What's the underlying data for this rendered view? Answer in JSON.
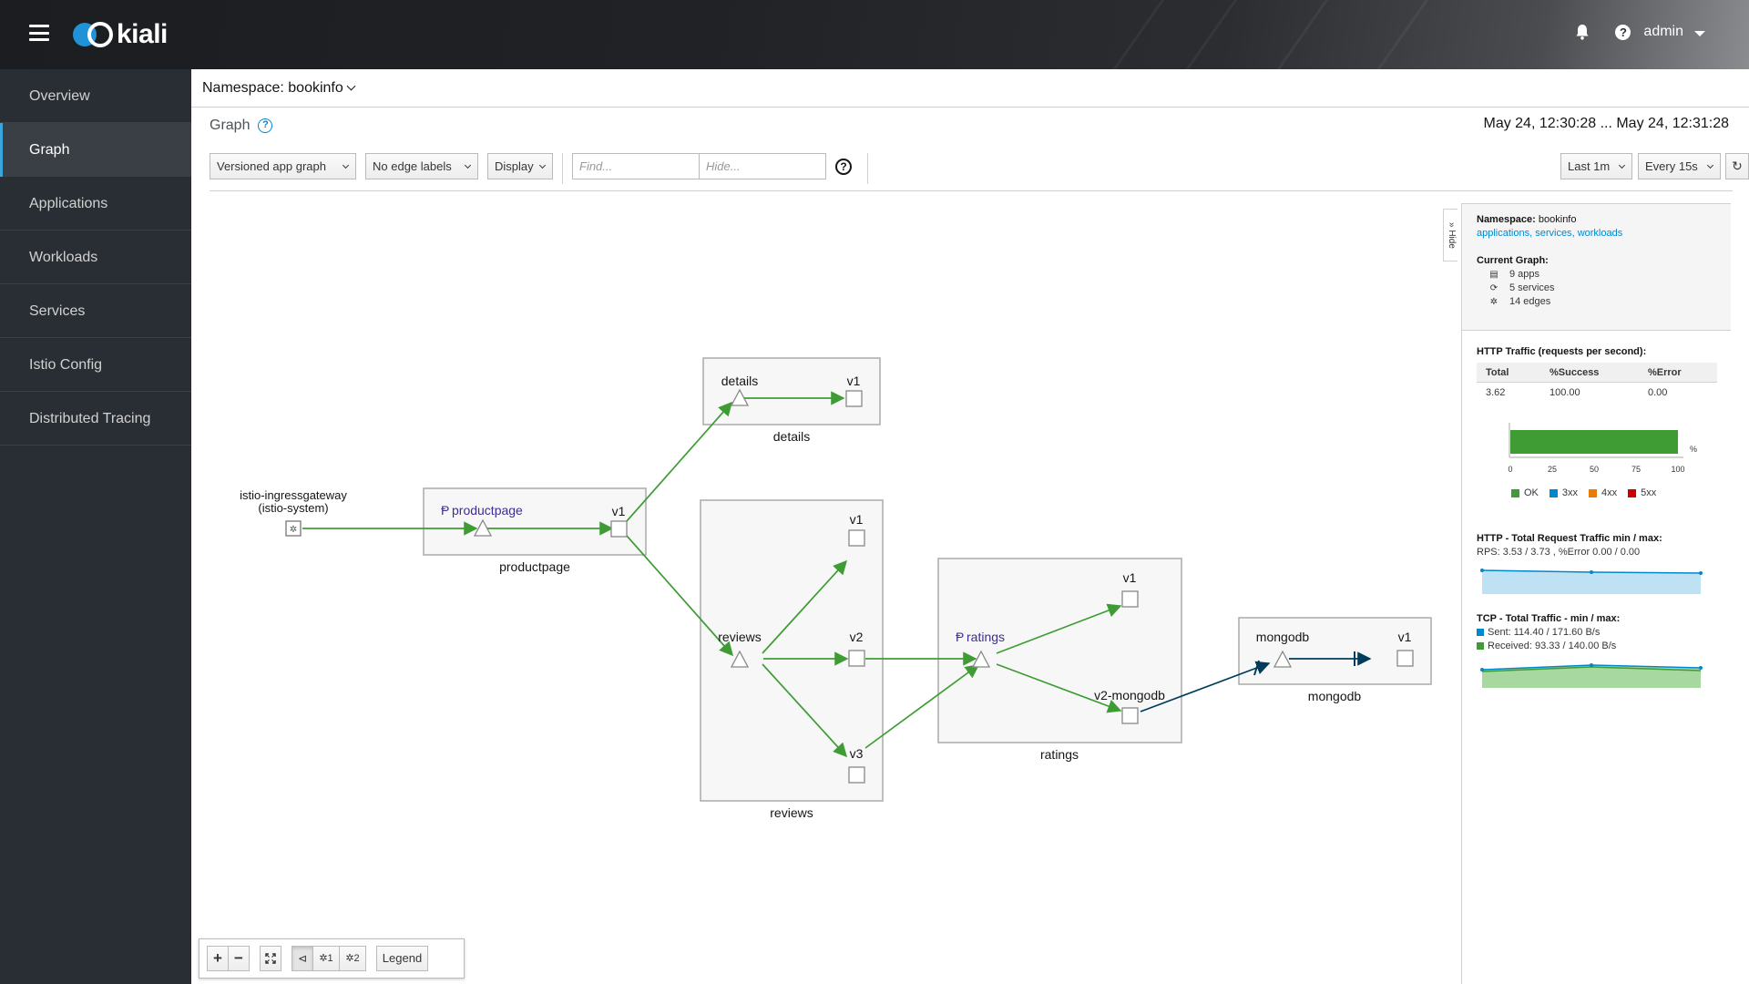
{
  "masthead": {
    "logo_text": "kiali",
    "help_label": "?",
    "user": "admin"
  },
  "sidebar": {
    "items": [
      {
        "label": "Overview"
      },
      {
        "label": "Graph"
      },
      {
        "label": "Applications"
      },
      {
        "label": "Workloads"
      },
      {
        "label": "Services"
      },
      {
        "label": "Istio Config"
      },
      {
        "label": "Distributed Tracing"
      }
    ],
    "active": "Graph"
  },
  "namespace_bar": {
    "label": "Namespace: bookinfo"
  },
  "page": {
    "title": "Graph",
    "help": "?",
    "time_range": "May 24, 12:30:28 ... May 24, 12:31:28"
  },
  "toolbar": {
    "graph_type": "Versioned app graph",
    "edge_labels": "No edge labels",
    "display": "Display",
    "find_placeholder": "Find...",
    "hide_placeholder": "Hide...",
    "help": "?",
    "duration": "Last 1m",
    "refresh_interval": "Every 15s",
    "refresh_icon": "↻"
  },
  "graph": {
    "groups": {
      "details": "details",
      "productpage": "productpage",
      "reviews": "reviews",
      "ratings": "ratings",
      "mongodb": "mongodb"
    },
    "nodes": {
      "ingress_line1": "istio-ingressgateway",
      "ingress_line2": "(istio-system)",
      "productpage_app": "productpage",
      "productpage_v1": "v1",
      "details_app": "details",
      "details_v1": "v1",
      "reviews_app": "reviews",
      "reviews_v1": "v1",
      "reviews_v2": "v2",
      "reviews_v3": "v3",
      "ratings_app": "ratings",
      "ratings_v1": "v1",
      "ratings_v2": "v2-mongodb",
      "mongodb_app": "mongodb",
      "mongodb_v1": "v1"
    },
    "colors": {
      "http_edge": "#3f9c35",
      "tcp_edge": "#003d5c",
      "virtual_service": "#3f2d8f",
      "group_box": "#f7f7f7"
    }
  },
  "hide_tab": "» Hide",
  "side_panel": {
    "namespace_label": "Namespace:",
    "namespace_value": "bookinfo",
    "links": {
      "apps": "applications",
      "services": "services",
      "workloads": "workloads"
    },
    "current_graph": "Current Graph:",
    "counts": {
      "apps": "9 apps",
      "services": "5 services",
      "edges": "14 edges"
    },
    "http_title": "HTTP Traffic (requests per second):",
    "table": {
      "headers": [
        "Total",
        "%Success",
        "%Error"
      ],
      "row": [
        "3.62",
        "100.00",
        "0.00"
      ]
    },
    "bar": {
      "ok_percent": 100,
      "ticks": [
        "0",
        "25",
        "50",
        "75",
        "100"
      ],
      "unit": "%",
      "legend": [
        "OK",
        "3xx",
        "4xx",
        "5xx"
      ],
      "legend_colors": [
        "#3f9c35",
        "#0088ce",
        "#ec7a08",
        "#cc0000"
      ]
    },
    "http_spark_title": "HTTP - Total Request Traffic min / max:",
    "http_spark_sub": "RPS: 3.53 / 3.73 , %Error 0.00 / 0.00",
    "tcp_spark_title": "TCP - Total Traffic - min / max:",
    "tcp_sent": "Sent: 114.40 / 171.60 B/s",
    "tcp_received": "Received: 93.33 / 140.00 B/s"
  },
  "bottom_tools": {
    "zoom_in": "+",
    "zoom_out": "−",
    "layout1": "1",
    "layout2": "2",
    "legend": "Legend"
  }
}
